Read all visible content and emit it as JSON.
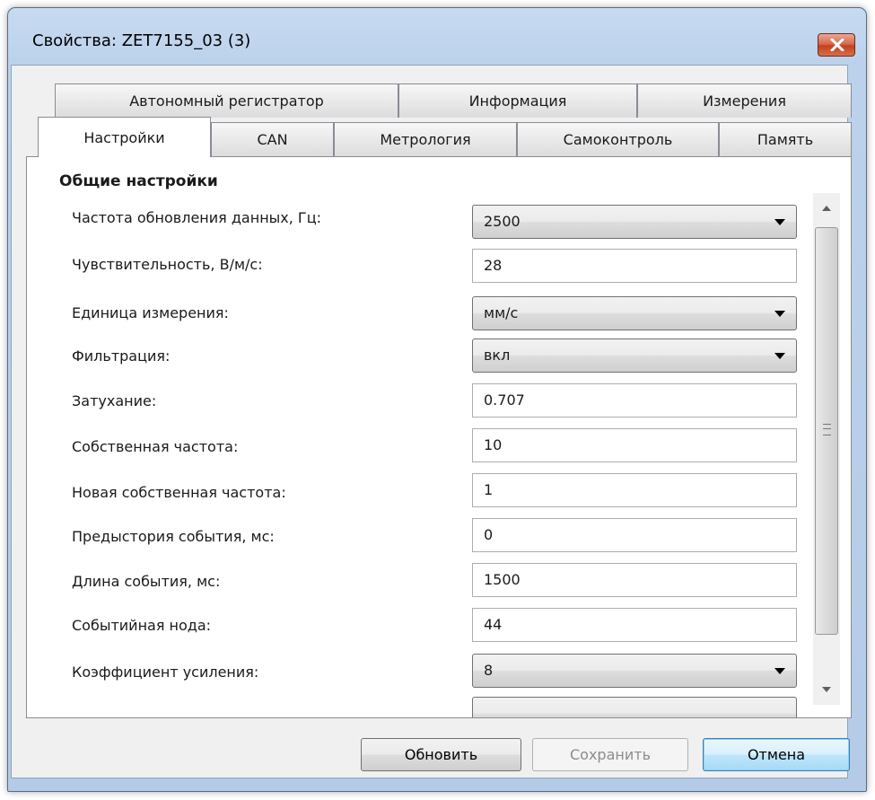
{
  "window": {
    "title": "Свойства: ZET7155_03 (3)"
  },
  "tabs": {
    "row_back": [
      {
        "label": "Автономный регистратор"
      },
      {
        "label": "Информация"
      },
      {
        "label": "Измерения"
      }
    ],
    "row_front": [
      {
        "label": "Настройки",
        "selected": true
      },
      {
        "label": "CAN"
      },
      {
        "label": "Метрология"
      },
      {
        "label": "Самоконтроль"
      },
      {
        "label": "Память"
      }
    ]
  },
  "settings": {
    "section_title": "Общие настройки",
    "rows": [
      {
        "label": "Частота обновления данных, Гц:",
        "type": "combo",
        "value": "2500"
      },
      {
        "label": "Чувствительность, В/м/с:",
        "type": "text",
        "value": "28"
      },
      {
        "label": "Единица измерения:",
        "type": "combo",
        "value": "мм/с"
      },
      {
        "label": "Фильтрация:",
        "type": "combo",
        "value": "вкл"
      },
      {
        "label": "Затухание:",
        "type": "text",
        "value": "0.707"
      },
      {
        "label": "Собственная частота:",
        "type": "text",
        "value": "10"
      },
      {
        "label": "Новая собственная частота:",
        "type": "text",
        "value": "1"
      },
      {
        "label": "Предыстория события, мс:",
        "type": "text",
        "value": "0"
      },
      {
        "label": "Длина события, мс:",
        "type": "text",
        "value": "1500"
      },
      {
        "label": "Событийная нода:",
        "type": "text",
        "value": "44"
      },
      {
        "label": "Коэффициент усиления:",
        "type": "combo",
        "value": "8"
      }
    ]
  },
  "buttons": {
    "refresh": "Обновить",
    "save": "Сохранить",
    "cancel": "Отмена"
  },
  "colors": {
    "frame": "#bcd2ec",
    "close_button": "#c4401f",
    "default_button": "#bee6fd"
  }
}
